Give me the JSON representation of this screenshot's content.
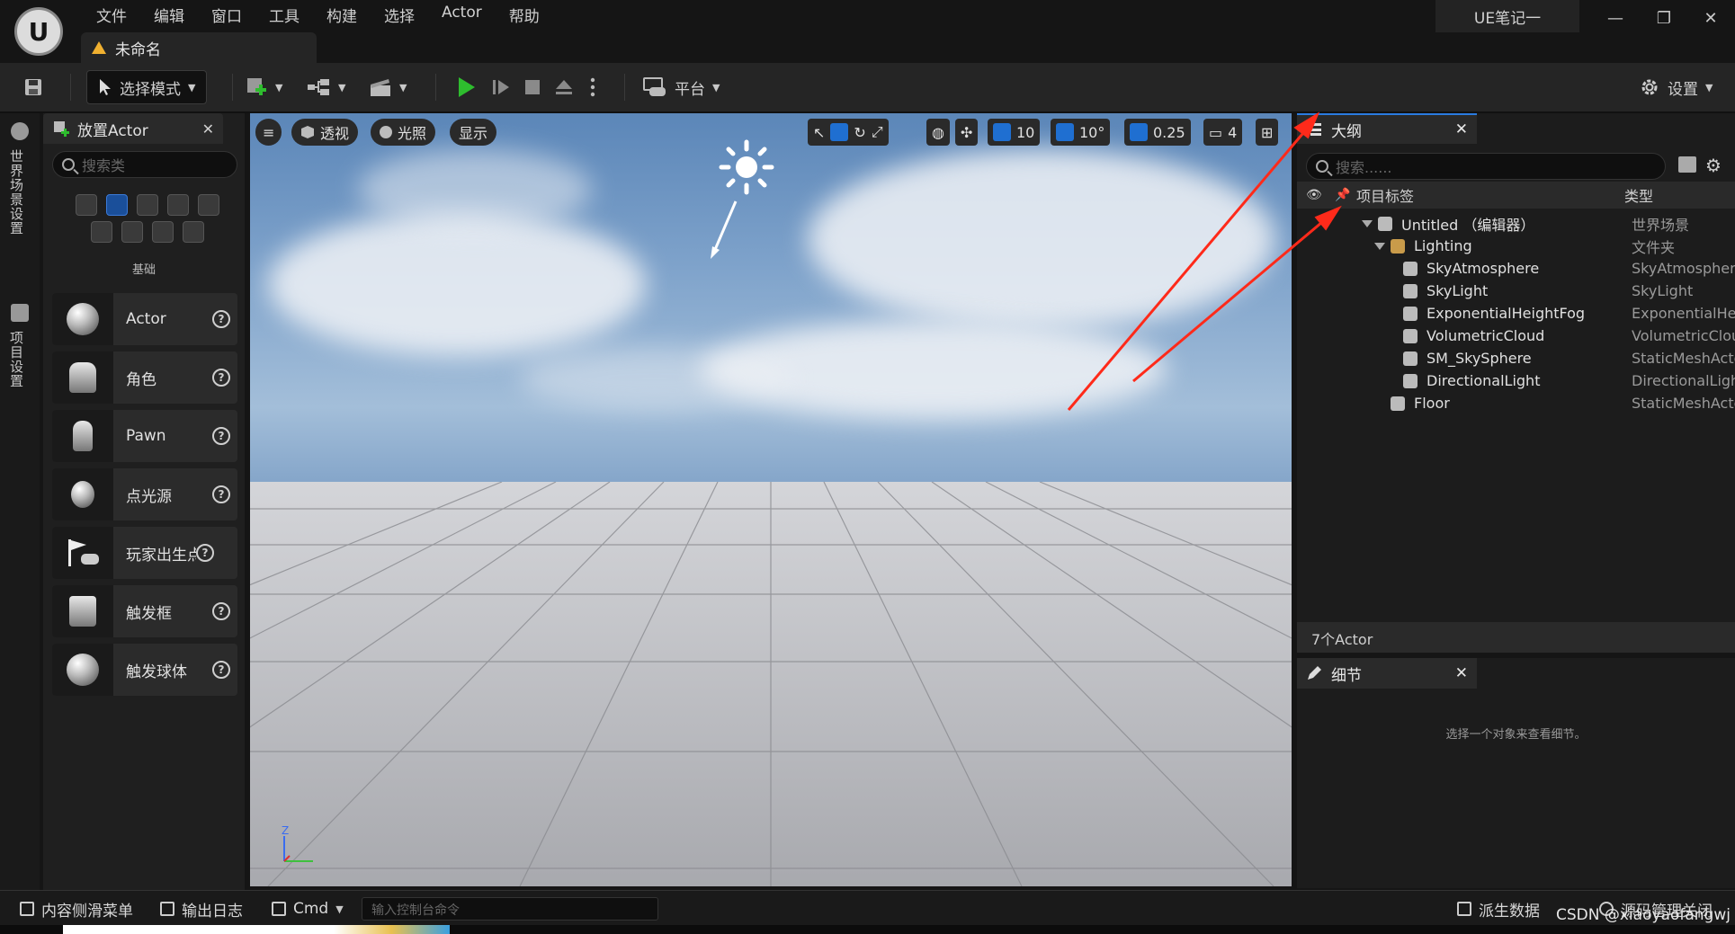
{
  "menu": [
    "文件",
    "编辑",
    "窗口",
    "工具",
    "构建",
    "选择",
    "Actor",
    "帮助"
  ],
  "doc_tab": "未命名",
  "project_name": "UE笔记一",
  "window_controls": {
    "minimize": "—",
    "restore": "❐",
    "close": "✕"
  },
  "toolbar": {
    "mode": "选择模式",
    "platform": "平台",
    "settings": "设置"
  },
  "left_rail": [
    "世界场景设置",
    "项目设置"
  ],
  "place_panel": {
    "title": "放置Actor",
    "search_placeholder": "搜索类",
    "category": "基础",
    "items": [
      "Actor",
      "角色",
      "Pawn",
      "点光源",
      "玩家出生点",
      "触发框",
      "触发球体"
    ]
  },
  "viewport": {
    "menu_icon": "≡",
    "perspective": "透视",
    "lit": "光照",
    "show": "显示",
    "grid_snap": "10",
    "rot_snap": "10°",
    "scale_snap": "0.25",
    "camera_speed": "4",
    "axis_z": "Z"
  },
  "outliner": {
    "title": "大纲",
    "search_placeholder": "搜索......",
    "col_label": "项目标签",
    "col_type": "类型",
    "rows": [
      {
        "label": "Untitled （编辑器）",
        "type": "世界场景"
      },
      {
        "label": "Lighting",
        "type": "文件夹"
      },
      {
        "label": "SkyAtmosphere",
        "type": "SkyAtmosphere"
      },
      {
        "label": "SkyLight",
        "type": "SkyLight"
      },
      {
        "label": "ExponentialHeightFog",
        "type": "ExponentialHeightFog"
      },
      {
        "label": "VolumetricCloud",
        "type": "VolumetricCloud"
      },
      {
        "label": "SM_SkySphere",
        "type": "StaticMeshActor"
      },
      {
        "label": "DirectionalLight",
        "type": "DirectionalLight"
      },
      {
        "label": "Floor",
        "type": "StaticMeshActor"
      }
    ],
    "count": "7个Actor"
  },
  "details": {
    "title": "细节",
    "empty": "选择一个对象来查看细节。"
  },
  "statusbar": {
    "content_drawer": "内容侧滑菜单",
    "output_log": "输出日志",
    "cmd": "Cmd",
    "console_placeholder": "输入控制台命令",
    "derived_data": "派生数据",
    "source_control": "源码管理关闭"
  },
  "watermark": "CSDN @xiaoyaofangwj"
}
